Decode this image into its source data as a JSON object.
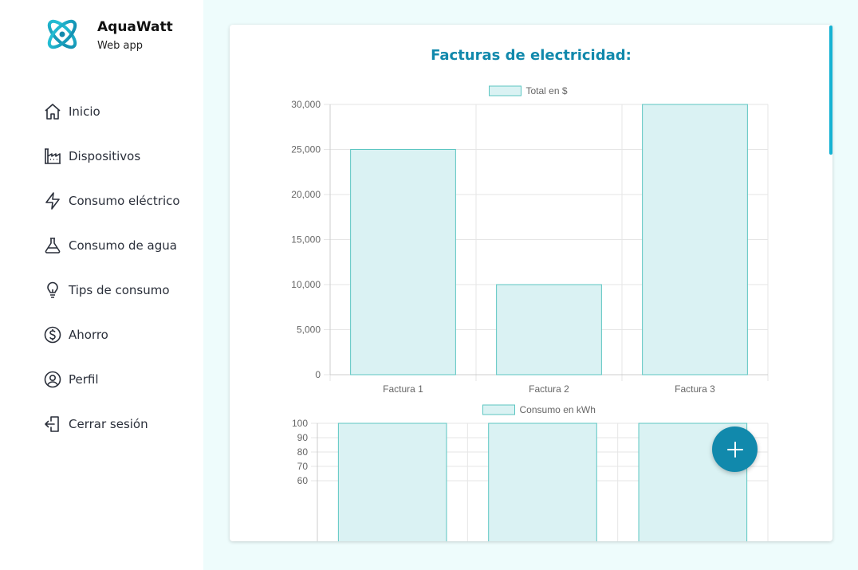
{
  "app": {
    "name": "AquaWatt",
    "subtitle": "Web app"
  },
  "sidebar": {
    "items": [
      {
        "label": "Inicio",
        "icon": "home-icon"
      },
      {
        "label": "Dispositivos",
        "icon": "factory-icon"
      },
      {
        "label": "Consumo eléctrico",
        "icon": "bolt-icon"
      },
      {
        "label": "Consumo de agua",
        "icon": "flask-icon"
      },
      {
        "label": "Tips de consumo",
        "icon": "bulb-icon"
      },
      {
        "label": "Ahorro",
        "icon": "dollar-icon"
      },
      {
        "label": "Perfil",
        "icon": "user-circle-icon"
      },
      {
        "label": "Cerrar sesión",
        "icon": "logout-icon"
      }
    ]
  },
  "main": {
    "title": "Facturas de electricidad:"
  },
  "colors": {
    "accent": "#1189ac",
    "bar_fill": "#daf2f3",
    "bar_stroke": "#5cc6c2",
    "scrollbar": "#15b2d3",
    "background": "#eefcfc"
  },
  "fab": {
    "icon": "plus-icon"
  },
  "chart_data": [
    {
      "type": "bar",
      "categories": [
        "Factura 1",
        "Factura 2",
        "Factura 3"
      ],
      "series": [
        {
          "name": "Total en $",
          "values": [
            25000,
            10000,
            30000
          ]
        }
      ],
      "ylim": [
        0,
        30000
      ],
      "yticks": [
        "30,000",
        "25,000",
        "20,000",
        "15,000",
        "10,000",
        "5,000",
        "0"
      ],
      "grid": true,
      "legend": "top-center"
    },
    {
      "type": "bar",
      "categories": [
        "",
        "",
        ""
      ],
      "series": [
        {
          "name": "Consumo en kWh",
          "values": [
            100,
            100,
            100
          ]
        }
      ],
      "ylim": [
        0,
        100
      ],
      "yticks": [
        "100",
        "90",
        "80",
        "70",
        "60"
      ],
      "grid": true,
      "legend": "top-center"
    }
  ]
}
